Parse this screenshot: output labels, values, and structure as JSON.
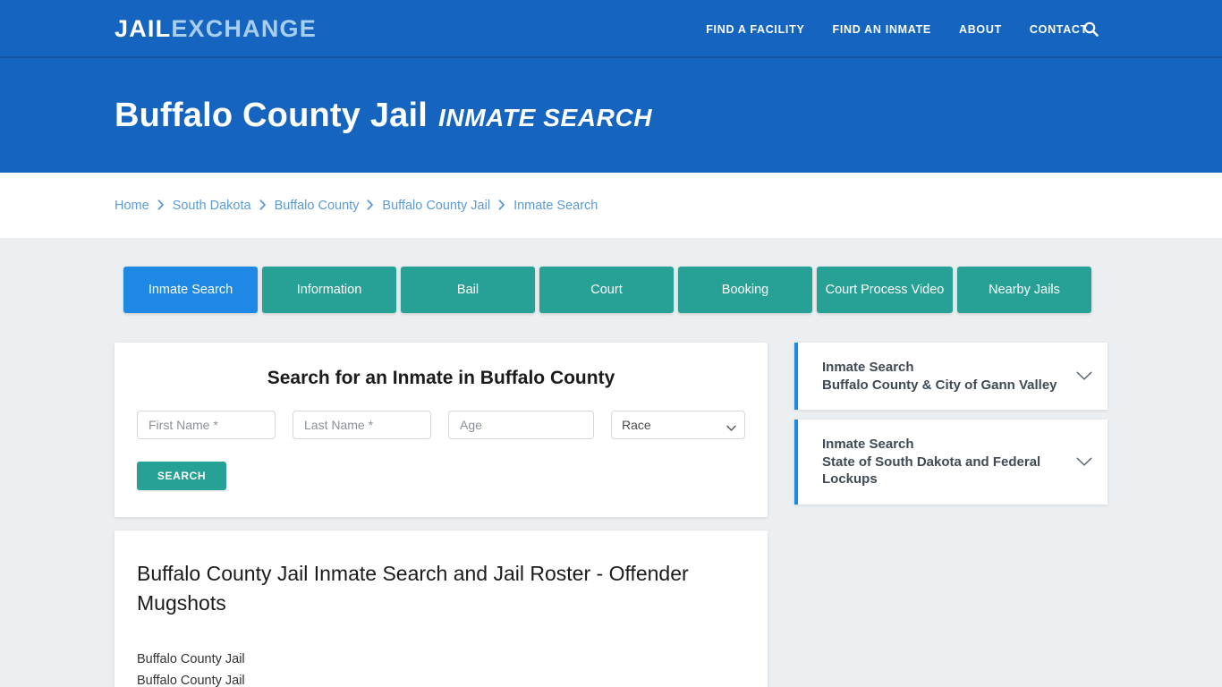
{
  "brand": {
    "name_part1": "JAIL",
    "name_part2": "EXCHANGE"
  },
  "nav": {
    "items": [
      {
        "label": "FIND A FACILITY"
      },
      {
        "label": "FIND AN INMATE"
      },
      {
        "label": "ABOUT"
      },
      {
        "label": "CONTACT"
      }
    ],
    "search_icon": "search-icon"
  },
  "hero": {
    "title": "Buffalo County Jail",
    "subtitle": "INMATE SEARCH"
  },
  "breadcrumb": {
    "items": [
      {
        "label": "Home"
      },
      {
        "label": "South Dakota"
      },
      {
        "label": "Buffalo County"
      },
      {
        "label": "Buffalo County Jail"
      },
      {
        "label": "Inmate Search"
      }
    ],
    "separator_icon": "chevron-right-icon"
  },
  "tabs": [
    {
      "label": "Inmate Search",
      "active": true
    },
    {
      "label": "Information",
      "active": false
    },
    {
      "label": "Bail",
      "active": false
    },
    {
      "label": "Court",
      "active": false
    },
    {
      "label": "Booking",
      "active": false
    },
    {
      "label": "Court Process Video",
      "active": false
    },
    {
      "label": "Nearby Jails",
      "active": false
    }
  ],
  "search_form": {
    "heading": "Search for an Inmate in Buffalo County",
    "first_name": {
      "value": "",
      "placeholder": "First Name *"
    },
    "last_name": {
      "value": "",
      "placeholder": "Last Name *"
    },
    "age": {
      "value": "",
      "placeholder": "Age"
    },
    "race": {
      "selected": "Race",
      "options": [
        "Race"
      ]
    },
    "submit_label": "SEARCH"
  },
  "article": {
    "title": "Buffalo County Jail Inmate Search and Jail Roster - Offender Mugshots",
    "line1": "Buffalo County Jail",
    "line2": "Buffalo County Jail"
  },
  "sidebar": {
    "panels": [
      {
        "title": "Inmate Search",
        "subtitle": "Buffalo County & City of Gann Valley",
        "chevron_icon": "chevron-down-icon"
      },
      {
        "title": "Inmate Search",
        "subtitle": "State of South Dakota and Federal Lockups",
        "chevron_icon": "chevron-down-icon"
      }
    ]
  },
  "colors": {
    "header_blue": "#1565c0",
    "accent_blue": "#1e88e5",
    "teal": "#27a195",
    "page_bg": "#eceff1",
    "link_blue": "#5b9bd5"
  }
}
